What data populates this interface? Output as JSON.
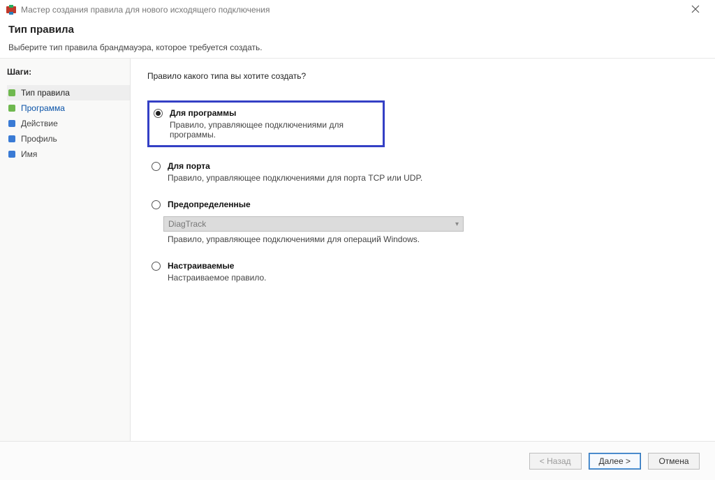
{
  "window": {
    "title": "Мастер создания правила для нового исходящего подключения"
  },
  "header": {
    "title": "Тип правила",
    "subtitle": "Выберите тип правила брандмауэра, которое требуется создать."
  },
  "sidebar": {
    "steps_title": "Шаги:",
    "steps": [
      {
        "label": "Тип правила"
      },
      {
        "label": "Программа"
      },
      {
        "label": "Действие"
      },
      {
        "label": "Профиль"
      },
      {
        "label": "Имя"
      }
    ]
  },
  "content": {
    "question": "Правило какого типа вы хотите создать?",
    "options": {
      "program": {
        "label": "Для программы",
        "desc": "Правило, управляющее подключениями для программы."
      },
      "port": {
        "label": "Для порта",
        "desc": "Правило, управляющее подключениями для порта TCP или UDP."
      },
      "predefined": {
        "label": "Предопределенные",
        "select_value": "DiagTrack",
        "desc": "Правило, управляющее подключениями для операций Windows."
      },
      "custom": {
        "label": "Настраиваемые",
        "desc": "Настраиваемое правило."
      }
    }
  },
  "footer": {
    "back": "< Назад",
    "next": "Далее >",
    "cancel": "Отмена"
  }
}
